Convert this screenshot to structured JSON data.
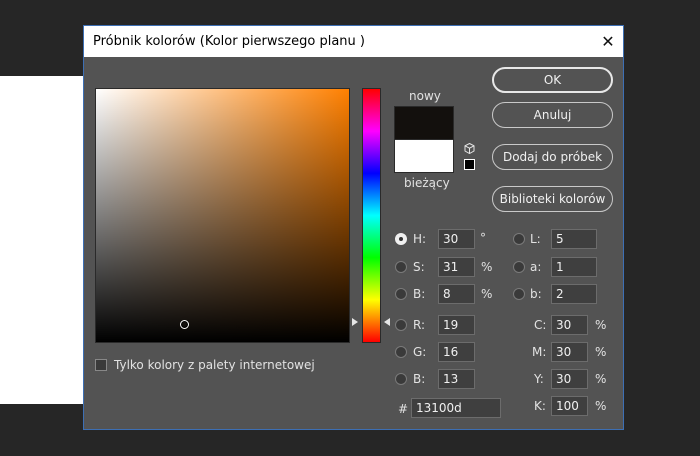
{
  "dialog": {
    "title": "Próbnik kolorów (Kolor pierwszego planu )",
    "close_glyph": "✕"
  },
  "preview": {
    "new_label": "nowy",
    "current_label": "bieżący",
    "new_color": "#13100d",
    "current_color": "#ffffff"
  },
  "buttons": {
    "ok": "OK",
    "cancel": "Anuluj",
    "add_swatch": "Dodaj do próbek",
    "libraries": "Biblioteki kolorów"
  },
  "hsb": {
    "h": {
      "label": "H:",
      "value": "30",
      "unit": "°",
      "selected": true
    },
    "s": {
      "label": "S:",
      "value": "31",
      "unit": "%"
    },
    "b": {
      "label": "B:",
      "value": "8",
      "unit": "%"
    }
  },
  "rgb": {
    "r": {
      "label": "R:",
      "value": "19"
    },
    "g": {
      "label": "G:",
      "value": "16"
    },
    "b": {
      "label": "B:",
      "value": "13"
    }
  },
  "lab": {
    "l": {
      "label": "L:",
      "value": "5"
    },
    "a": {
      "label": "a:",
      "value": "1"
    },
    "b": {
      "label": "b:",
      "value": "2"
    }
  },
  "cmyk": {
    "c": {
      "label": "C:",
      "value": "30",
      "unit": "%"
    },
    "m": {
      "label": "M:",
      "value": "30",
      "unit": "%"
    },
    "y": {
      "label": "Y:",
      "value": "30",
      "unit": "%"
    },
    "k": {
      "label": "K:",
      "value": "100",
      "unit": "%"
    }
  },
  "hex": {
    "label": "#",
    "value": "13100d"
  },
  "web_colors_only": {
    "label": "Tylko kolory z palety internetowej",
    "checked": false
  }
}
